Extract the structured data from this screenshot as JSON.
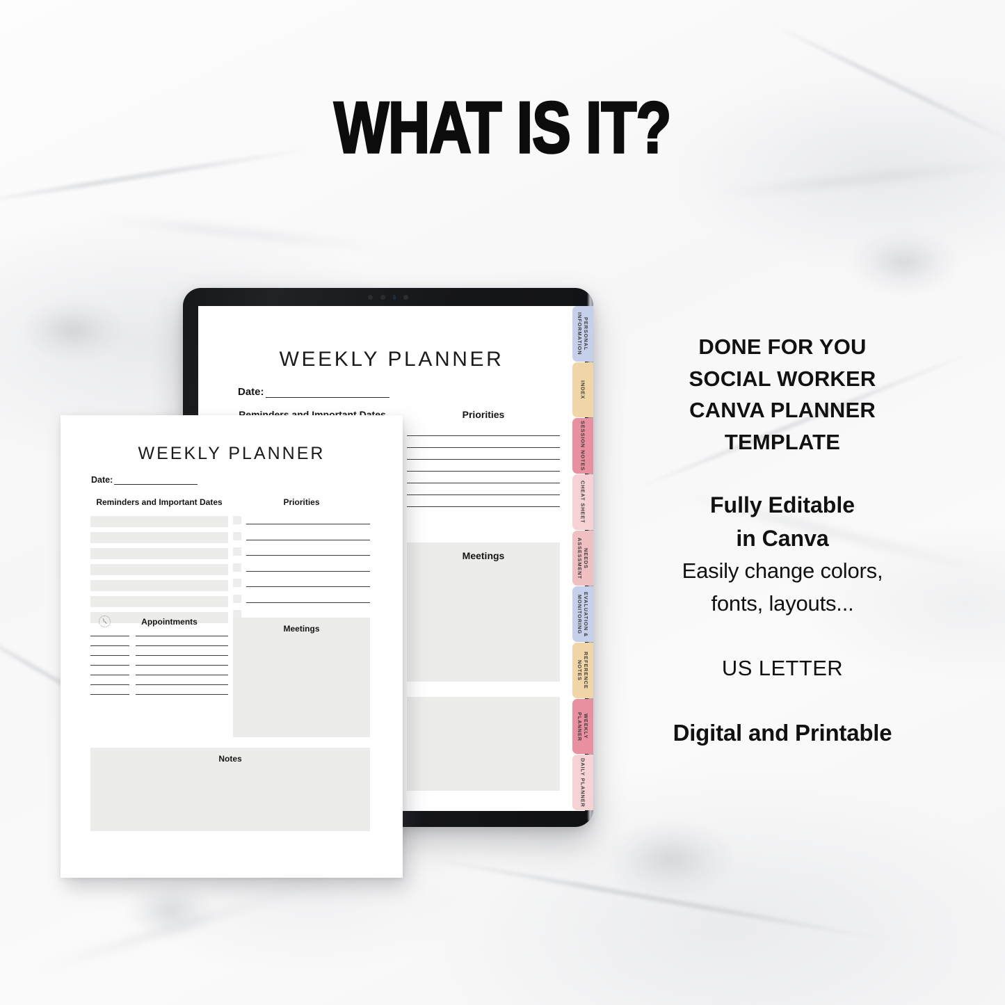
{
  "headline": "WHAT IS IT?",
  "copy": {
    "block_a": [
      "DONE FOR YOU",
      "SOCIAL WORKER",
      "CANVA PLANNER",
      "TEMPLATE"
    ],
    "block_b": [
      "Fully Editable",
      "in Canva"
    ],
    "block_c": [
      "Easily change colors,",
      "fonts, layouts..."
    ],
    "block_d": "US LETTER",
    "block_e": "Digital and Printable"
  },
  "tablet": {
    "tabs": [
      {
        "label": "PERSONAL\nINFORMATION",
        "color": "#c6d0ea"
      },
      {
        "label": "INDEX",
        "color": "#f0d5a6"
      },
      {
        "label": "SESSION NOTES",
        "color": "#e8909f"
      },
      {
        "label": "CHEAT SHEET",
        "color": "#f6d2d4"
      },
      {
        "label": "NEEDS\nASSESSMENT",
        "color": "#efbfc1"
      },
      {
        "label": "EVALUATION &\nMONITORING",
        "color": "#c6d0ea"
      },
      {
        "label": "REFERENCE\nNOTES",
        "color": "#f0d5a6"
      },
      {
        "label": "WEEKLY PLANNER",
        "color": "#e8909f"
      },
      {
        "label": "DAILY PLANNER",
        "color": "#f6d2d4"
      }
    ],
    "screen": {
      "title": "WEEKLY PLANNER",
      "date_label": "Date:",
      "reminders_heading": "Reminders and Important Dates",
      "priorities_heading": "Priorities",
      "meetings_heading": "Meetings",
      "priority_rows": 7
    }
  },
  "paper": {
    "title": "WEEKLY PLANNER",
    "date_label": "Date:",
    "reminders_heading": "Reminders and Important Dates",
    "priorities_heading": "Priorities",
    "appointments_heading": "Appointments",
    "meetings_heading": "Meetings",
    "notes_heading": "Notes",
    "reminder_bars": 7,
    "priority_rows": 7,
    "appointment_rows": 7
  },
  "colors": {
    "background": "#fafafa",
    "gray_box": "#ececea",
    "rule": "#3a3a3a",
    "text": "#111111"
  }
}
